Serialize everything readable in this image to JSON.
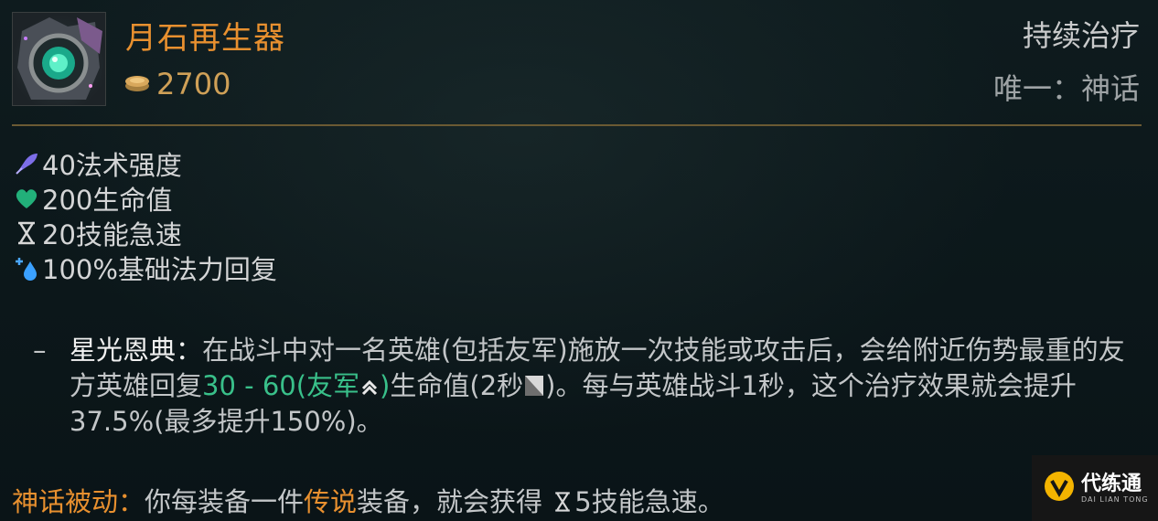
{
  "item": {
    "name": "月石再生器",
    "price": "2700",
    "tags": [
      "持续治疗",
      "唯一：神话"
    ]
  },
  "stats": [
    {
      "icon": "ability-power-icon",
      "text": "40法术强度"
    },
    {
      "icon": "health-icon",
      "text": "200生命值"
    },
    {
      "icon": "ability-haste-icon",
      "text": "20技能急速"
    },
    {
      "icon": "mana-regen-icon",
      "text": "100%基础法力回复"
    }
  ],
  "passive": {
    "dash": "–",
    "name": "星光恩典：",
    "text1": "在战斗中对一名英雄(包括友军)施放一次技能或攻击后，会给附近伤势最重的友方英雄回复",
    "heal": "30 - 60(友军",
    "heal_close": ")",
    "text2": "生命值(2秒",
    "text3": ")。每与英雄战斗1秒，这个治疗效果就会提升37.5%(最多提升150%)。"
  },
  "mythic": {
    "label": "神话被动：",
    "text1": "你每装备一件",
    "highlight": "传说",
    "text2": "装备，就会获得 ",
    "text3": "5技能急速。"
  },
  "watermark": {
    "brand": "代练通",
    "sub": "DAI LIAN TONG"
  }
}
